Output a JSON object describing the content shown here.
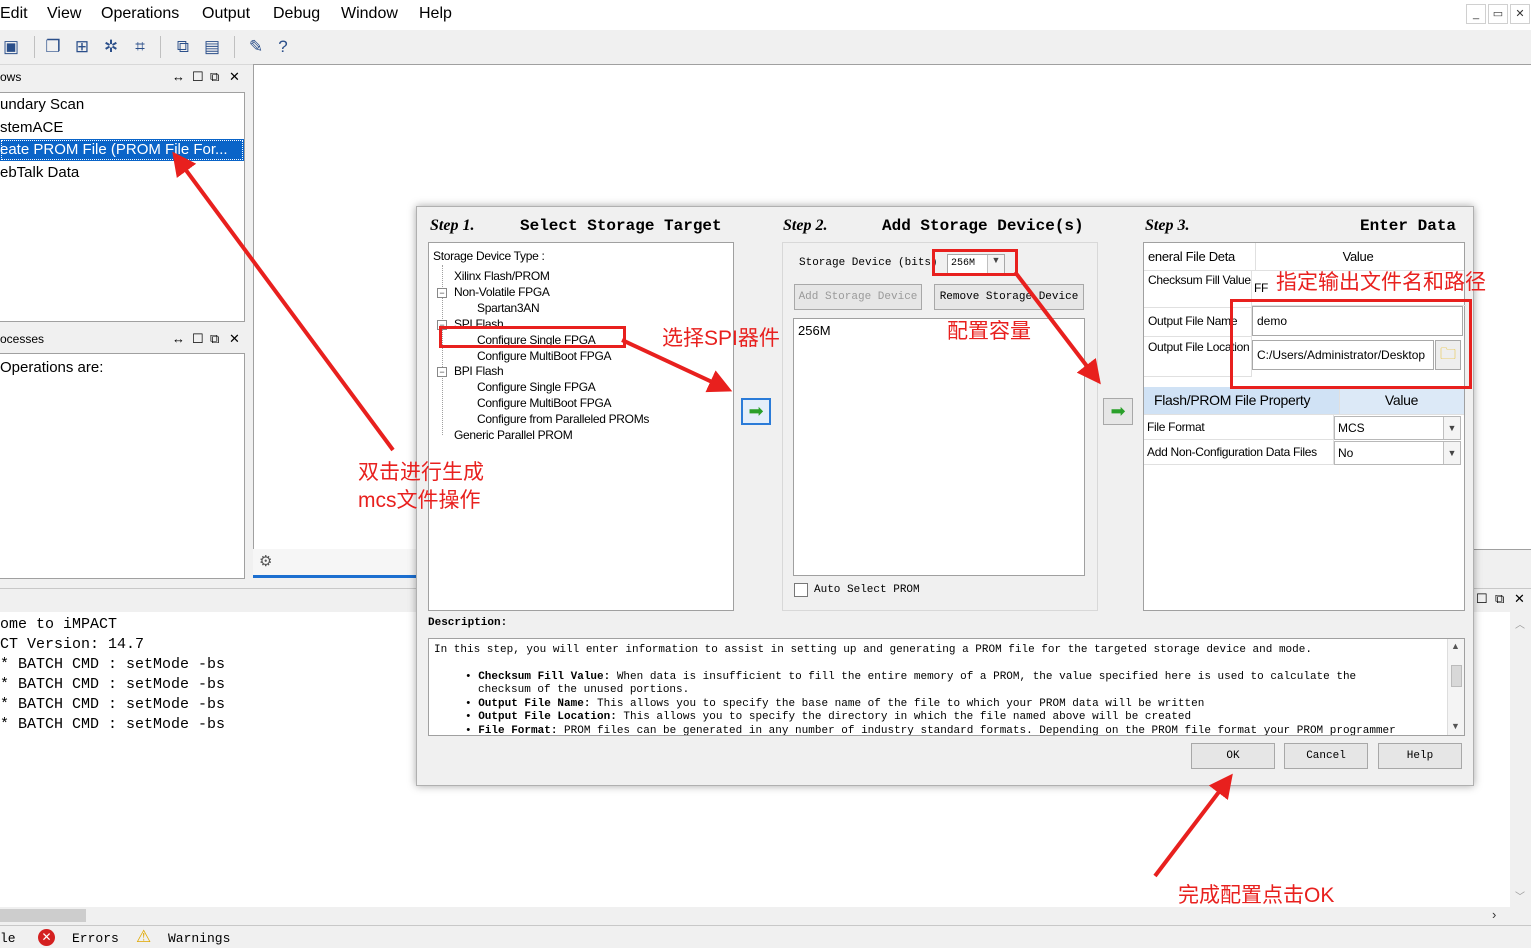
{
  "menu": {
    "items": [
      "Edit",
      "View",
      "Operations",
      "Output",
      "Debug",
      "Window",
      "Help"
    ]
  },
  "toolbar": {
    "icons": [
      "save-icon",
      "copy-icon",
      "chain-icon",
      "initialize-chain-icon",
      "chip-icon",
      "cascade-icon",
      "tile-icon",
      "wrench-icon",
      "help-pointer-icon"
    ]
  },
  "flows_panel": {
    "title": "ows",
    "items": [
      "undary Scan",
      "stemACE",
      "eate PROM File (PROM File For...",
      "ebTalk Data"
    ]
  },
  "processes_panel": {
    "title": "ocesses",
    "text": " Operations are:"
  },
  "console": {
    "lines": [
      "ome to iMPACT",
      "CT Version: 14.7",
      "* BATCH CMD : setMode -bs",
      "* BATCH CMD : setMode -bs",
      "* BATCH CMD : setMode -bs",
      "* BATCH CMD : setMode -bs"
    ]
  },
  "bottom_tabs": {
    "console": "le",
    "errors": "Errors",
    "warnings": "Warnings"
  },
  "dialog": {
    "step1": {
      "num": "Step 1.",
      "title": "Select Storage Target"
    },
    "step2": {
      "num": "Step 2.",
      "title": "Add Storage Device(s)"
    },
    "step3": {
      "num": "Step 3.",
      "title": "Enter Data"
    },
    "tree": {
      "header": "Storage Device Type :",
      "xilinx": "Xilinx Flash/PROM",
      "nonvolatile": "Non-Volatile FPGA",
      "spartan": "Spartan3AN",
      "spi": "SPI Flash",
      "spi_single": "Configure Single FPGA",
      "spi_multi": "Configure MultiBoot FPGA",
      "bpi": "BPI Flash",
      "bpi_single": "Configure Single FPGA",
      "bpi_multi": "Configure MultiBoot FPGA",
      "bpi_parallel": "Configure from Paralleled PROMs",
      "generic": "Generic Parallel PROM"
    },
    "storage": {
      "label": "Storage Device (bits)",
      "value": "256M",
      "add_button": "Add Storage Device",
      "remove_button": "Remove Storage Device",
      "list": [
        "256M"
      ],
      "auto_select": "Auto Select PROM"
    },
    "general": {
      "col_name": "eneral File Deta",
      "col_value": "Value",
      "checksum_label": "Checksum Fill Value",
      "checksum_value": "FF",
      "name_label": "Output File Name",
      "name_value": "demo",
      "location_label": "Output File Location",
      "location_value": "C:/Users/Administrator/Desktop"
    },
    "property": {
      "col_name": "Flash/PROM File Property",
      "col_value": "Value",
      "format_label": "File Format",
      "format_value": "MCS",
      "nonconfig_label": "Add Non-Configuration Data Files",
      "nonconfig_value": "No"
    },
    "description": {
      "label": "Description:",
      "intro": "In this step, you will enter information to assist in setting up and generating a PROM file for the targeted storage device and mode.",
      "b1_title": "Checksum Fill Value:",
      "b1_text": " When data is insufficient to fill the entire memory of a PROM, the value specified here is used to calculate the",
      "b1_cont": "checksum of the unused portions.",
      "b2_title": "Output File Name:",
      "b2_text": " This allows you to specify the base name of the file to which your PROM data will be written",
      "b3_title": "Output File Location:",
      "b3_text": " This allows you to specify the directory in which the file named above will be created",
      "b4_title": "File Format:",
      "b4_text": " PROM files can be generated in any number of industry standard formats. Depending on the PROM file format your PROM programmer"
    },
    "buttons": {
      "ok": "OK",
      "cancel": "Cancel",
      "help": "Help"
    }
  },
  "annotations": {
    "double_click": [
      "双击进行生成",
      "mcs文件操作"
    ],
    "select_spi": "选择SPI器件",
    "capacity": "配置容量",
    "output": "指定输出文件名和路径",
    "finish": "完成配置点击OK"
  },
  "colors": {
    "annotation_red": "#e8201e",
    "selection_blue": "#0a64c8",
    "workspace_tab_blue": "#1c6fd0"
  }
}
